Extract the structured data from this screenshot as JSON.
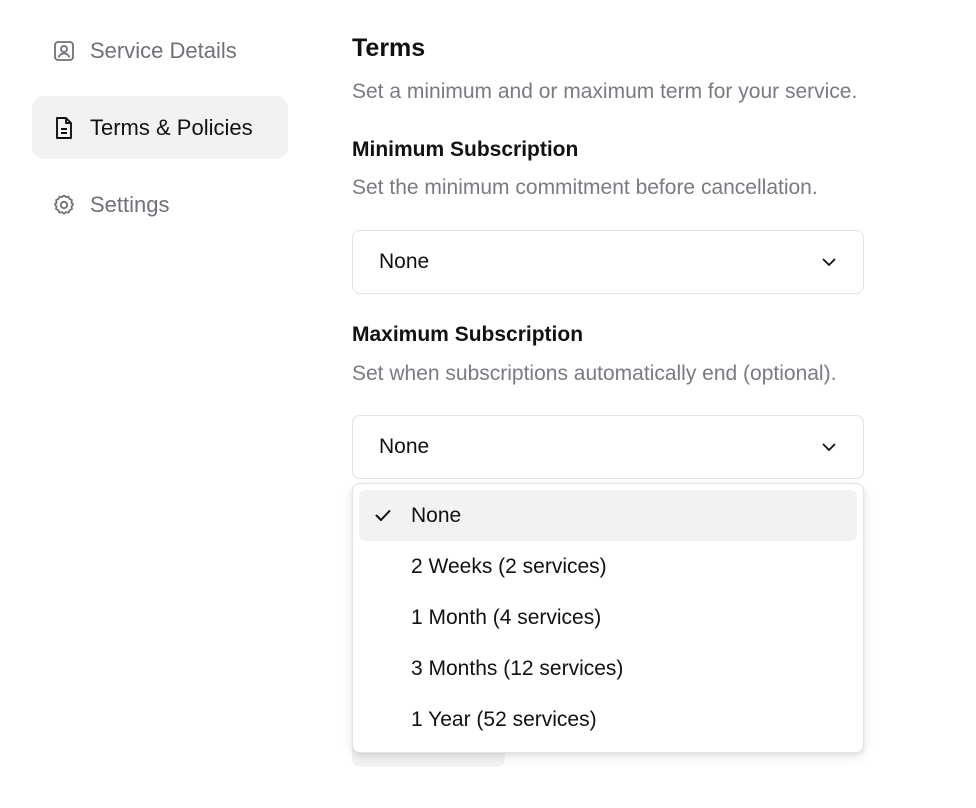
{
  "sidebar": {
    "items": [
      {
        "label": "Service Details",
        "icon": "user-square-icon"
      },
      {
        "label": "Terms & Policies",
        "icon": "document-icon",
        "active": true
      },
      {
        "label": "Settings",
        "icon": "gear-icon"
      }
    ]
  },
  "main": {
    "title": "Terms",
    "description": "Set a minimum and or maximum term for your service.",
    "minimum": {
      "label": "Minimum Subscription",
      "description": "Set the minimum commitment before cancellation.",
      "value": "None"
    },
    "maximum": {
      "label": "Maximum Subscription",
      "description": "Set when subscriptions automatically end (optional).",
      "value": "None",
      "options": [
        {
          "label": "None",
          "selected": true
        },
        {
          "label": "2 Weeks (2 services)"
        },
        {
          "label": "1 Month (4 services)"
        },
        {
          "label": "3 Months (12 services)"
        },
        {
          "label": "1 Year (52 services)"
        }
      ]
    }
  },
  "colors": {
    "active_bg": "#f2f2f3",
    "muted_text": "#7a7a83",
    "border": "#e2e2e6"
  }
}
